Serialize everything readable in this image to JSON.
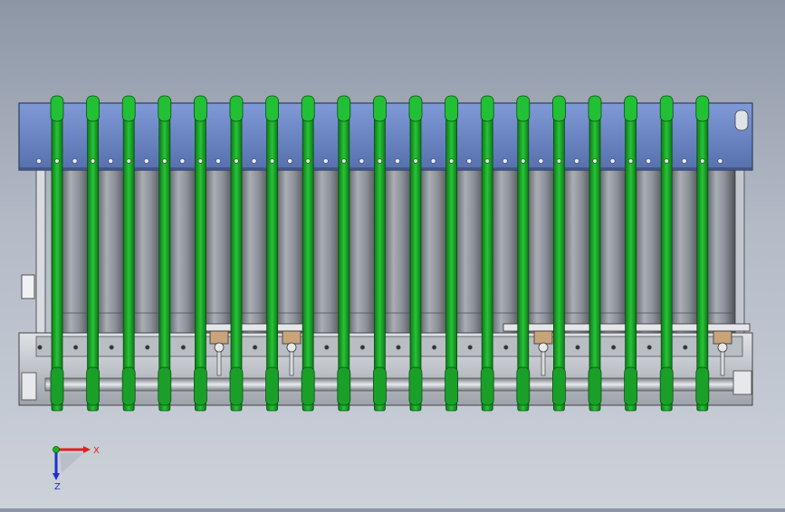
{
  "viewport": {
    "background_top": "#8d96a6",
    "background_bottom": "#cdd2da"
  },
  "model": {
    "name": "",
    "belt_count": 19,
    "carriage_count": 4,
    "colors": {
      "frame": "#6a86c4",
      "frame_dark": "#3e5484",
      "belt": "#1fae2e",
      "belt_dark": "#0c6a16",
      "roller": "#8e939b",
      "rail": "#c9ccd2",
      "carriage": "#c9a37a"
    }
  },
  "triad": {
    "x_label": "X",
    "z_label": "Z",
    "icon": "coordinate-triad-icon",
    "x_color": "#e02020",
    "y_color": "#20b020",
    "z_color": "#2030d0"
  }
}
